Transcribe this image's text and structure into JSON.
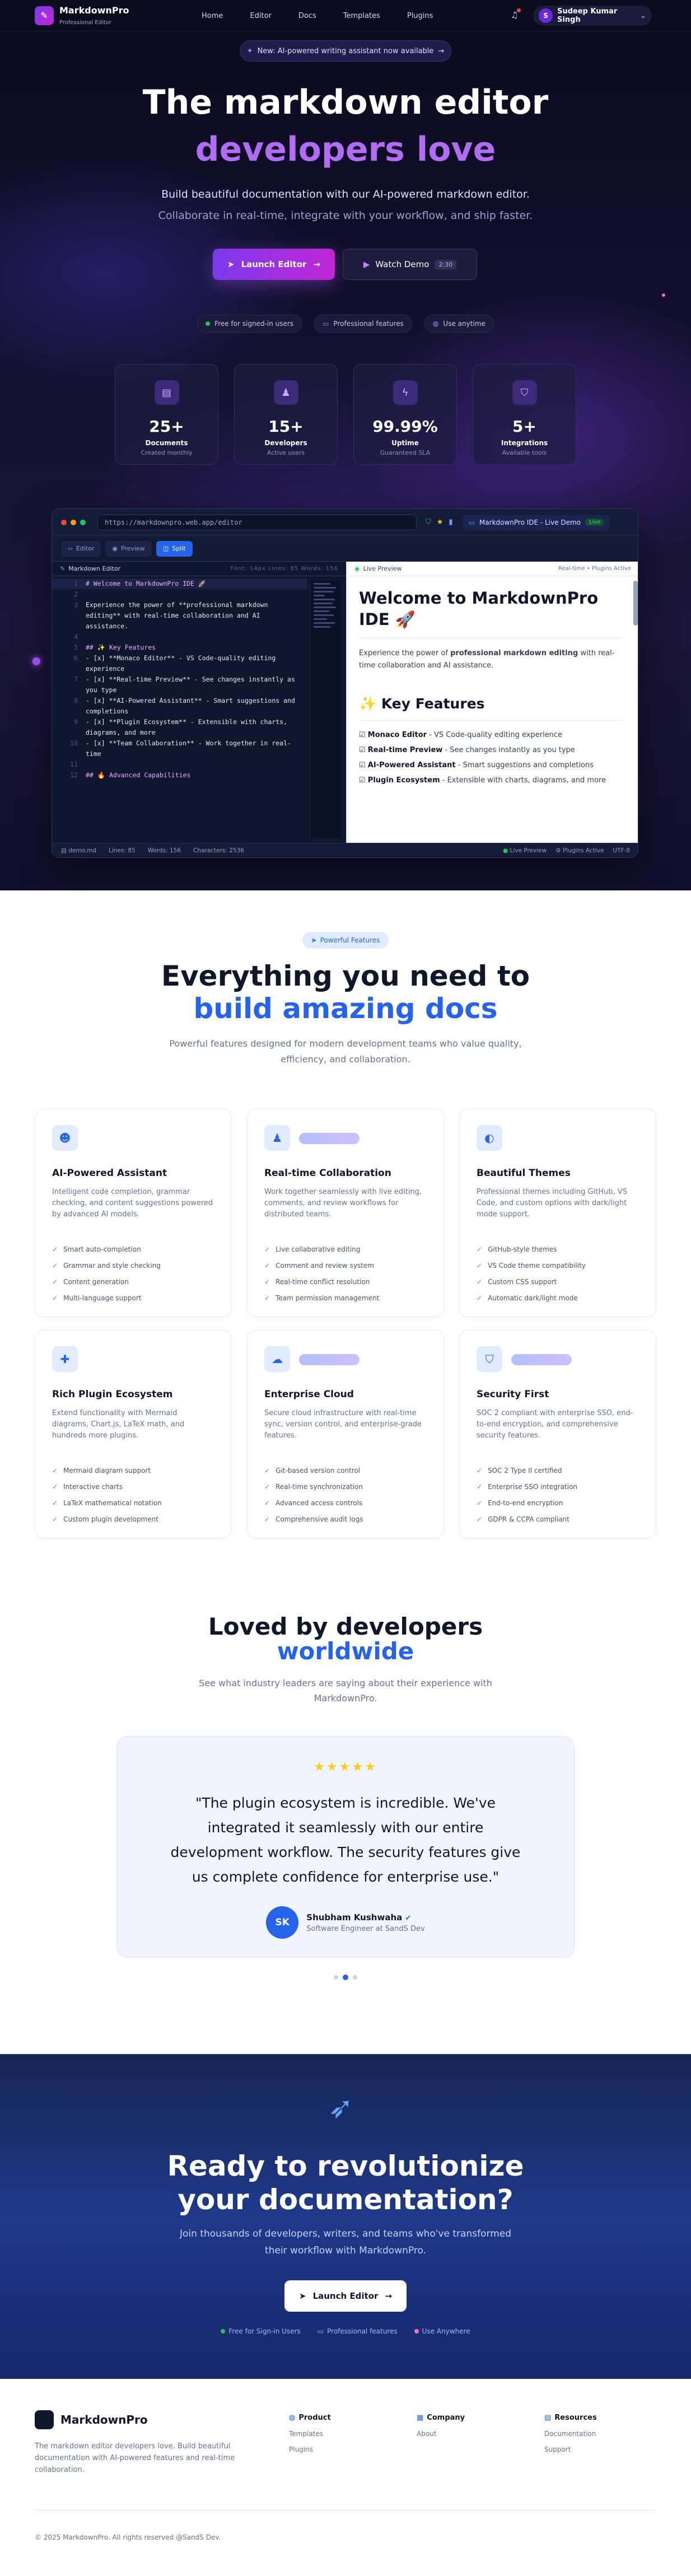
{
  "nav": {
    "brand": "MarkdownPro",
    "brand_sub": "Professional Editor",
    "links": [
      "Home",
      "Editor",
      "Docs",
      "Templates",
      "Plugins"
    ],
    "user_initial": "S",
    "user_name": "Sudeep Kumar Singh"
  },
  "hero": {
    "announcement": "New: AI-powered writing assistant now available",
    "title_line1": "The markdown editor",
    "title_line2": "developers love",
    "subtitle1": "Build beautiful documentation with our AI-powered markdown editor.",
    "subtitle2": "Collaborate in real-time, integrate with your workflow, and ship faster.",
    "launch_label": "Launch Editor",
    "demo_label": "Watch Demo",
    "demo_duration": "2:30",
    "chips": [
      {
        "label": "Free for signed-in users",
        "color": "#22c55e"
      },
      {
        "label": "Professional features",
        "color": "#60a5fa"
      },
      {
        "label": "Use anytime",
        "color": "#a78bfa"
      }
    ],
    "stats": [
      {
        "value": "25+",
        "label": "Documents",
        "desc": "Created monthly"
      },
      {
        "value": "15+",
        "label": "Developers",
        "desc": "Active users"
      },
      {
        "value": "99.99%",
        "label": "Uptime",
        "desc": "Guaranteed SLA"
      },
      {
        "value": "5+",
        "label": "Integrations",
        "desc": "Available tools"
      }
    ]
  },
  "ide": {
    "url": "https://markdownpro.web.app/editor",
    "window_title": "MarkdownPro IDE - Live Demo",
    "live_badge": "Live",
    "toolbar": [
      "Editor",
      "Preview",
      "Split"
    ],
    "editor_label": "Markdown Editor",
    "editor_meta": "Font: 14px  Lines: 85  Words: 156",
    "preview_label": "Live Preview",
    "preview_meta": "Real-time • Plugins Active",
    "code_lines": [
      {
        "n": "1",
        "text": "# Welcome to MarkdownPro IDE 🚀"
      },
      {
        "n": "2",
        "text": ""
      },
      {
        "n": "3",
        "text": "Experience the power of **professional markdown editing** with real-time collaboration and AI assistance."
      },
      {
        "n": "4",
        "text": ""
      },
      {
        "n": "5",
        "text": "## ✨ Key Features"
      },
      {
        "n": "6",
        "text": "- [x] **Monaco Editor** - VS Code-quality editing experience"
      },
      {
        "n": "7",
        "text": "- [x] **Real-time Preview** - See changes instantly as you type"
      },
      {
        "n": "8",
        "text": "- [x] **AI-Powered Assistant** - Smart suggestions and completions"
      },
      {
        "n": "9",
        "text": "- [x] **Plugin Ecosystem** - Extensible with charts, diagrams, and more"
      },
      {
        "n": "10",
        "text": "- [x] **Team Collaboration** - Work together in real-time"
      },
      {
        "n": "11",
        "text": ""
      },
      {
        "n": "12",
        "text": "## 🔥 Advanced Capabilities"
      }
    ],
    "preview_title": "Welcome to MarkdownPro IDE 🚀",
    "preview_intro_pre": "Experience the power of ",
    "preview_intro_bold": "professional markdown editing",
    "preview_intro_post": " with real-time collaboration and AI assistance.",
    "preview_h2": "✨ Key Features",
    "preview_items": [
      {
        "b": "Monaco Editor",
        "t": " - VS Code-quality editing experience"
      },
      {
        "b": "Real-time Preview",
        "t": " - See changes instantly as you type"
      },
      {
        "b": "AI-Powered Assistant",
        "t": " - Smart suggestions and completions"
      },
      {
        "b": "Plugin Ecosystem",
        "t": " - Extensible with charts, diagrams, and more"
      }
    ],
    "status_left": [
      "demo.md",
      "Lines: 85",
      "Words: 156",
      "Characters: 2536"
    ],
    "status_right": [
      "Live Preview",
      "Plugins Active",
      "UTF-8"
    ]
  },
  "features": {
    "tag": "Powerful Features",
    "title1": "Everything you need to",
    "title2": "build amazing docs",
    "subtitle": "Powerful features designed for modern development teams who value quality, efficiency, and collaboration.",
    "cards": [
      {
        "icon": "robot-icon",
        "glyph": "☻",
        "title": "AI-Powered Assistant",
        "desc": "Intelligent code completion, grammar checking, and content suggestions powered by advanced AI models.",
        "items": [
          "Smart auto-completion",
          "Grammar and style checking",
          "Content generation",
          "Multi-language support"
        ],
        "tag": false
      },
      {
        "icon": "users-icon",
        "glyph": "♟",
        "title": "Real-time Collaboration",
        "desc": "Work together seamlessly with live editing, comments, and review workflows for distributed teams.",
        "items": [
          "Live collaborative editing",
          "Comment and review system",
          "Real-time conflict resolution",
          "Team permission management"
        ],
        "tag": true
      },
      {
        "icon": "palette-icon",
        "glyph": "◐",
        "title": "Beautiful Themes",
        "desc": "Professional themes including GitHub, VS Code, and custom options with dark/light mode support.",
        "items": [
          "GitHub-style themes",
          "VS Code theme compatibility",
          "Custom CSS support",
          "Automatic dark/light mode"
        ],
        "tag": false
      },
      {
        "icon": "puzzle-icon",
        "glyph": "✚",
        "title": "Rich Plugin Ecosystem",
        "desc": "Extend functionality with Mermaid diagrams, Chart.js, LaTeX math, and hundreds more plugins.",
        "items": [
          "Mermaid diagram support",
          "Interactive charts",
          "LaTeX mathematical notation",
          "Custom plugin development"
        ],
        "tag": false
      },
      {
        "icon": "cloud-icon",
        "glyph": "☁",
        "title": "Enterprise Cloud",
        "desc": "Secure cloud infrastructure with real-time sync, version control, and enterprise-grade features.",
        "items": [
          "Git-based version control",
          "Real-time synchronization",
          "Advanced access controls",
          "Comprehensive audit logs"
        ],
        "tag": true
      },
      {
        "icon": "shield-icon",
        "glyph": "⛉",
        "title": "Security First",
        "desc": "SOC 2 compliant with enterprise SSO, end-to-end encryption, and comprehensive security features.",
        "items": [
          "SOC 2 Type II certified",
          "Enterprise SSO integration",
          "End-to-end encryption",
          "GDPR & CCPA compliant"
        ],
        "tag": true
      }
    ]
  },
  "testimonials": {
    "title1": "Loved by developers",
    "title2": "worldwide",
    "subtitle": "See what industry leaders are saying about their experience with MarkdownPro.",
    "rating": 5,
    "stars": "★★★★★",
    "quote": "\"The plugin ecosystem is incredible. We've integrated it seamlessly with our entire development workflow. The security features give us complete confidence for enterprise use.\"",
    "initials": "SK",
    "name": "Shubham Kushwaha",
    "role": "Software Engineer at SandS Dev"
  },
  "cta": {
    "title_line1": "Ready to revolutionize",
    "title_line2": "your documentation?",
    "subtitle": "Join thousands of developers, writers, and teams who've transformed their workflow with MarkdownPro.",
    "button": "Launch Editor",
    "chips": [
      {
        "label": "Free for Sign-in Users",
        "color": "#22c55e"
      },
      {
        "label": "Professional features",
        "color": "#a5b4fc"
      },
      {
        "label": "Use Anywhere",
        "color": "#f472b6"
      }
    ]
  },
  "footer": {
    "brand": "MarkdownPro",
    "desc": "The markdown editor developers love. Build beautiful documentation with AI-powered features and real-time collaboration.",
    "cols": [
      {
        "title": "Product",
        "links": [
          "Templates",
          "Plugins"
        ]
      },
      {
        "title": "Company",
        "links": [
          "About"
        ]
      },
      {
        "title": "Resources",
        "links": [
          "Documentation",
          "Support"
        ]
      }
    ],
    "copyright": "© 2025 MarkdownPro. All rights reserved @SandS Dev."
  }
}
